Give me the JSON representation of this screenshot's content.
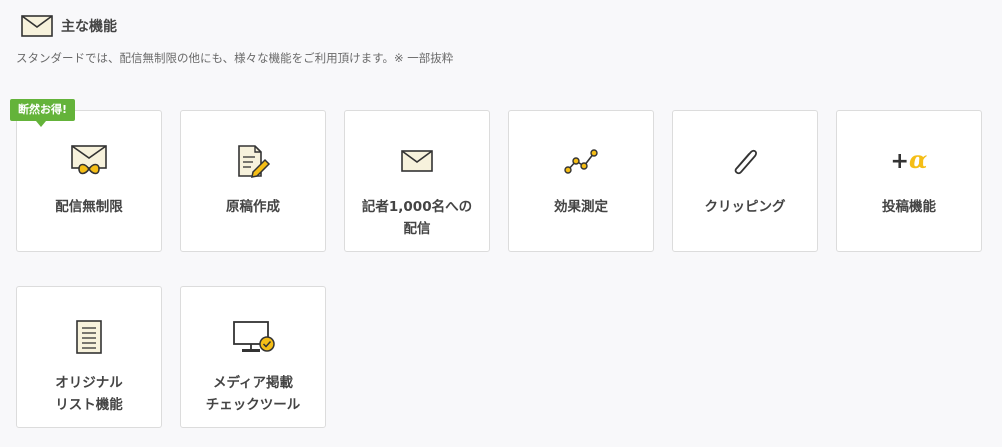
{
  "header": {
    "title": "主な機能",
    "icon": "envelope-icon"
  },
  "subtitle": "スタンダードでは、配信無制限の他にも、様々な機能をご利用頂けます。※ 一部抜粋",
  "badge": "断然お得!",
  "colors": {
    "accent": "#f5be16",
    "badge": "#64b33a",
    "text": "#444444"
  },
  "features": [
    {
      "label": "配信無制限",
      "icon": "envelope-infinity-icon"
    },
    {
      "label": "原稿作成",
      "icon": "document-pen-icon"
    },
    {
      "label": "記者1,000名への\n配信",
      "icon": "envelope-icon"
    },
    {
      "label": "効果測定",
      "icon": "line-chart-icon"
    },
    {
      "label": "クリッピング",
      "icon": "paperclip-icon"
    },
    {
      "label": "投稿機能",
      "icon": "plus-alpha-icon",
      "icon_text": "+",
      "icon_alpha": "α"
    },
    {
      "label": "オリジナル\nリスト機能",
      "icon": "list-document-icon"
    },
    {
      "label": "メディア掲載\nチェックツール",
      "icon": "monitor-check-icon"
    }
  ]
}
